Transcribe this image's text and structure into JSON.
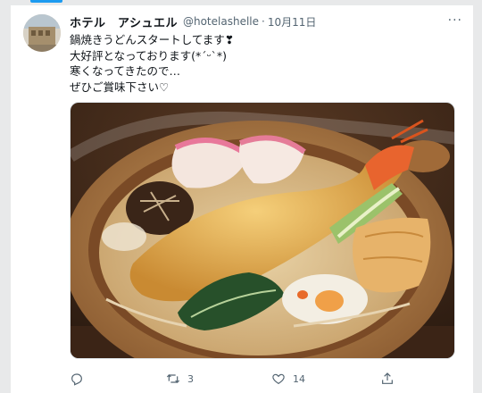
{
  "tweet": {
    "display_name": "ホテル　アシュエル",
    "handle": "@hotelashelle",
    "separator": "·",
    "date": "10月11日",
    "more": "···",
    "lines": [
      "鍋焼きうどんスタートしてます❣",
      "大好評となっております(*´ᵕ`*)",
      "寒くなってきたので…",
      "ぜひご賞味下さい♡"
    ]
  },
  "actions": {
    "reply_count": "",
    "retweet_count": "3",
    "like_count": "14"
  },
  "icons": {
    "reply": "reply-icon",
    "retweet": "retweet-icon",
    "like": "heart-icon",
    "share": "share-icon",
    "more": "more-icon"
  },
  "colors": {
    "accent": "#1d9bf0",
    "text": "#0f1419",
    "secondary": "#536471"
  }
}
